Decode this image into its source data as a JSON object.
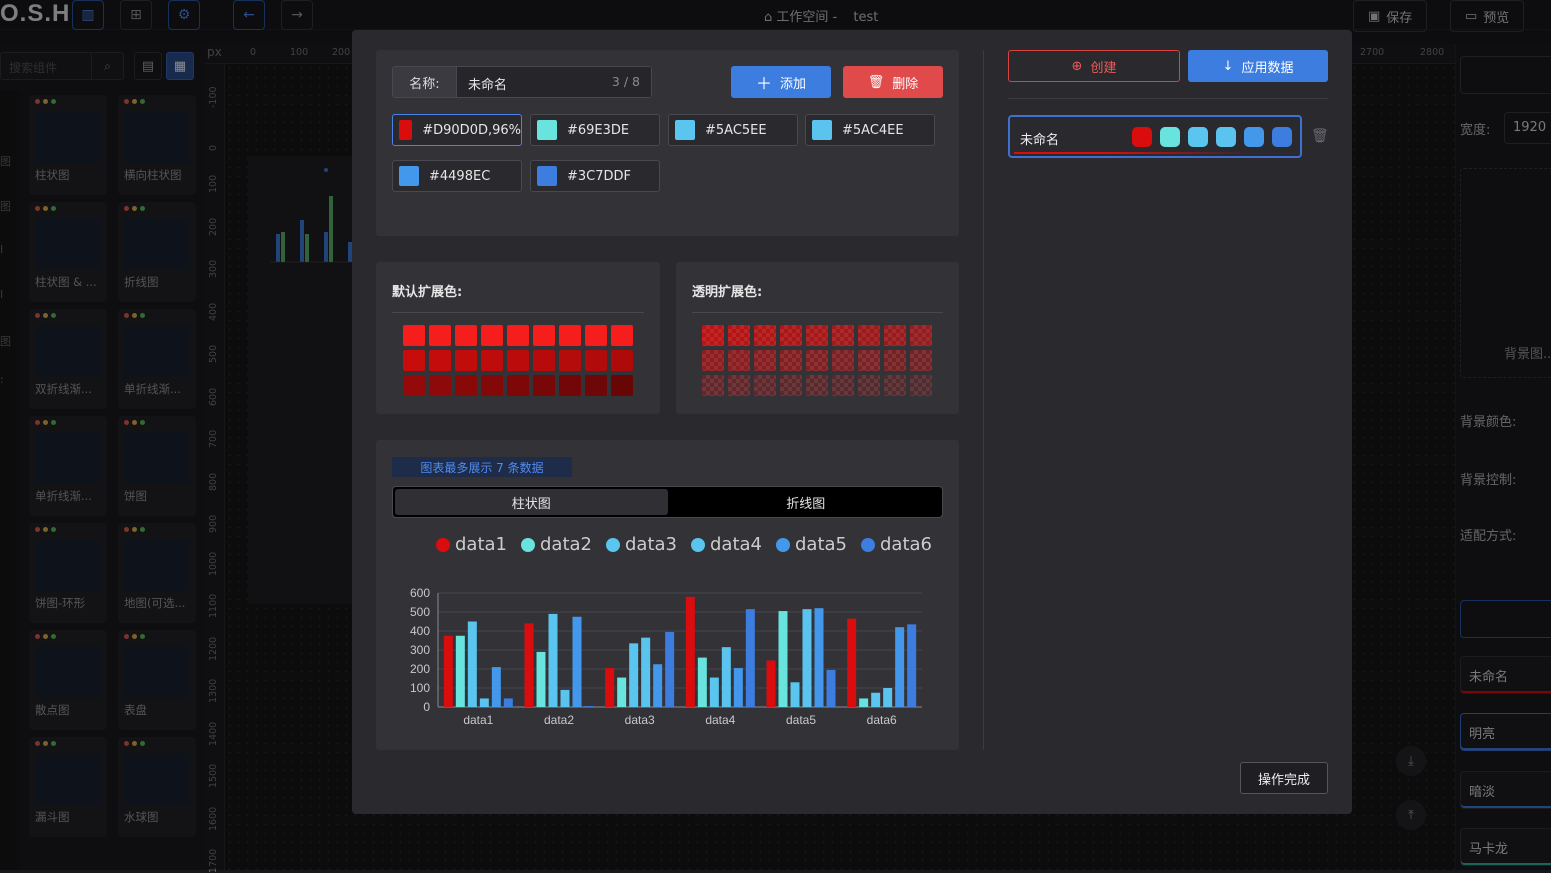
{
  "app": {
    "logo": "O.S.H",
    "workspace_label": "工作空间 -",
    "project_name": "test"
  },
  "topbar": {
    "save": "保存",
    "preview": "预览"
  },
  "left": {
    "search_placeholder": "搜索组件",
    "nav_chars": [
      "图",
      "图",
      "I",
      "I",
      "图",
      ":"
    ],
    "components": [
      {
        "label": "柱状图"
      },
      {
        "label": "横向柱状图"
      },
      {
        "label": "柱状图 & ..."
      },
      {
        "label": "折线图"
      },
      {
        "label": "双折线渐..."
      },
      {
        "label": "单折线渐..."
      },
      {
        "label": "单折线渐..."
      },
      {
        "label": "饼图"
      },
      {
        "label": "饼图-环形"
      },
      {
        "label": "地图(可选..."
      },
      {
        "label": "散点图"
      },
      {
        "label": "表盘"
      },
      {
        "label": "漏斗图"
      },
      {
        "label": "水球图"
      }
    ]
  },
  "ruler": {
    "unit": "px",
    "top": [
      "0",
      "100",
      "200",
      "2700",
      "2800"
    ],
    "left": [
      "-100",
      "0",
      "100",
      "200",
      "300",
      "400",
      "500",
      "600",
      "700",
      "800",
      "900",
      "1000",
      "1100",
      "1200",
      "1300",
      "1400",
      "1500",
      "1600",
      "1700"
    ]
  },
  "right": {
    "width_label": "宽度:",
    "width_value": "1920",
    "bg_image": "背景图...",
    "bg_color": "背景颜色:",
    "bg_control": "背景控制:",
    "fit_mode": "适配方式:",
    "themes": [
      "未命名",
      "明亮",
      "暗淡",
      "马卡龙"
    ]
  },
  "modal": {
    "name_label": "名称:",
    "name_value": "未命名",
    "name_count": "3 / 8",
    "add_label": "添加",
    "delete_label": "删除",
    "colors": [
      {
        "hex": "#D90D0D",
        "label": "#D90D0D,96%"
      },
      {
        "hex": "#69E3DE",
        "label": "#69E3DE"
      },
      {
        "hex": "#5AC5EE",
        "label": "#5AC5EE"
      },
      {
        "hex": "#5AC4EE",
        "label": "#5AC4EE"
      },
      {
        "hex": "#4498EC",
        "label": "#4498EC"
      },
      {
        "hex": "#3C7DDF",
        "label": "#3C7DDF"
      }
    ],
    "default_ext_title": "默认扩展色:",
    "transparent_ext_title": "透明扩展色:",
    "notice": "图表最多展示 7 条数据",
    "tabs": [
      "柱状图",
      "折线图"
    ],
    "active_tab": "柱状图",
    "create_label": "创建",
    "apply_label": "应用数据",
    "theme_name": "未命名",
    "done_label": "操作完成"
  },
  "chart_data": {
    "type": "bar",
    "categories": [
      "data1",
      "data2",
      "data3",
      "data4",
      "data5",
      "data6"
    ],
    "series": [
      {
        "name": "data1",
        "color": "#D90D0D",
        "values": [
          375,
          440,
          205,
          580,
          245,
          465
        ]
      },
      {
        "name": "data2",
        "color": "#69E3DE",
        "values": [
          375,
          290,
          155,
          260,
          505,
          45
        ]
      },
      {
        "name": "data3",
        "color": "#5AC5EE",
        "values": [
          450,
          490,
          335,
          155,
          130,
          75
        ]
      },
      {
        "name": "data4",
        "color": "#5AC4EE",
        "values": [
          45,
          90,
          365,
          315,
          515,
          100
        ]
      },
      {
        "name": "data5",
        "color": "#4498EC",
        "values": [
          210,
          475,
          225,
          205,
          520,
          420
        ]
      },
      {
        "name": "data6",
        "color": "#3C7DDF",
        "values": [
          45,
          5,
          395,
          515,
          195,
          435
        ]
      }
    ],
    "yticks": [
      "0",
      "100",
      "200",
      "300",
      "400",
      "500",
      "600"
    ],
    "ylim": [
      0,
      600
    ],
    "legend_position": "top"
  }
}
